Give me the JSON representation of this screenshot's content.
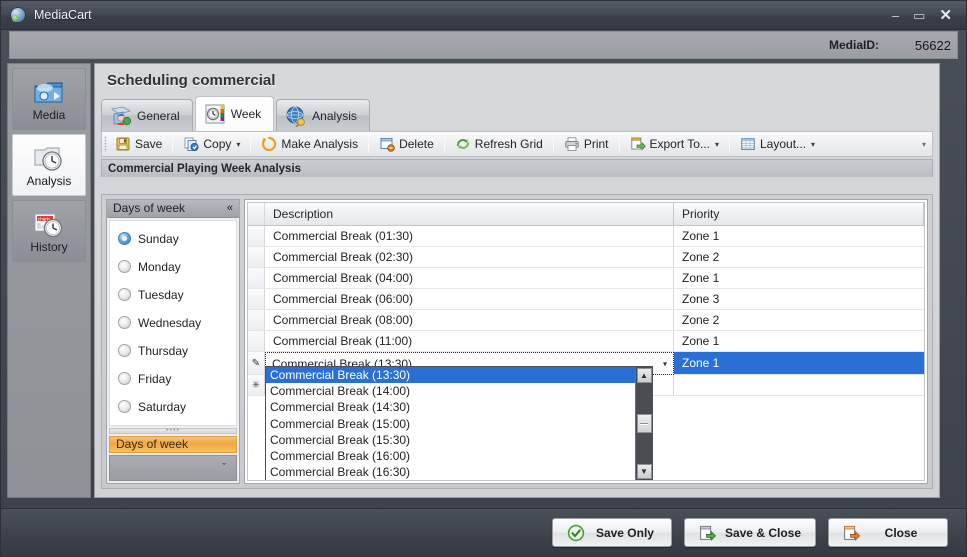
{
  "window": {
    "title": "MediaCart",
    "icon": "app-globe-icon",
    "minimize": "–",
    "maximize": "▭",
    "close": "✕"
  },
  "header": {
    "media_id_label": "MediaID:",
    "media_id_value": "56622"
  },
  "sidebar": {
    "items": [
      {
        "label": "Media",
        "icon": "media-folder-icon",
        "active": false
      },
      {
        "label": "Analysis",
        "icon": "analysis-clock-icon",
        "active": true
      },
      {
        "label": "History",
        "icon": "history-chart-icon",
        "active": false
      }
    ]
  },
  "content": {
    "title": "Scheduling commercial",
    "tabs": [
      {
        "label": "General",
        "icon": "general-person-icon",
        "active": false
      },
      {
        "label": "Week",
        "icon": "week-calendar-icon",
        "active": true
      },
      {
        "label": "Analysis",
        "icon": "analysis-globe-icon",
        "active": false
      }
    ],
    "group_caption": "Commercial Playing Week Analysis"
  },
  "toolbar": {
    "overflow": "▾",
    "buttons": [
      {
        "label": "Save",
        "icon": "save-disk-icon",
        "dropdown": false,
        "separator_after": true
      },
      {
        "label": "Copy",
        "icon": "copy-icon",
        "dropdown": true,
        "separator_after": true
      },
      {
        "label": "Make Analysis",
        "icon": "make-analysis-icon",
        "dropdown": false,
        "separator_after": true
      },
      {
        "label": "Delete",
        "icon": "delete-icon",
        "dropdown": false,
        "separator_after": true
      },
      {
        "label": "Refresh Grid",
        "icon": "refresh-icon",
        "dropdown": false,
        "separator_after": true
      },
      {
        "label": "Print",
        "icon": "print-icon",
        "dropdown": false,
        "separator_after": true
      },
      {
        "label": "Export To...",
        "icon": "export-icon",
        "dropdown": true,
        "separator_after": true
      },
      {
        "label": "Layout...",
        "icon": "layout-icon",
        "dropdown": true,
        "separator_after": false
      }
    ]
  },
  "dock_panel": {
    "header": "Days of week",
    "collapse_icon": "«",
    "tab_label": "Days of week",
    "footer_chevron": "ˇ",
    "days": [
      {
        "label": "Sunday",
        "checked": true
      },
      {
        "label": "Monday",
        "checked": false
      },
      {
        "label": "Tuesday",
        "checked": false
      },
      {
        "label": "Wednesday",
        "checked": false
      },
      {
        "label": "Thursday",
        "checked": false
      },
      {
        "label": "Friday",
        "checked": false
      },
      {
        "label": "Saturday",
        "checked": false
      }
    ]
  },
  "grid": {
    "columns": [
      "Description",
      "Priority"
    ],
    "rows": [
      {
        "description": "Commercial Break (01:30)",
        "priority": "Zone 1",
        "indicator": "",
        "selected": false,
        "editing": false
      },
      {
        "description": "Commercial Break (02:30)",
        "priority": "Zone 2",
        "indicator": "",
        "selected": false,
        "editing": false
      },
      {
        "description": "Commercial Break (04:00)",
        "priority": "Zone 1",
        "indicator": "",
        "selected": false,
        "editing": false
      },
      {
        "description": "Commercial Break (06:00)",
        "priority": "Zone 3",
        "indicator": "",
        "selected": false,
        "editing": false
      },
      {
        "description": "Commercial Break (08:00)",
        "priority": "Zone 2",
        "indicator": "",
        "selected": false,
        "editing": false
      },
      {
        "description": "Commercial Break (11:00)",
        "priority": "Zone 1",
        "indicator": "",
        "selected": false,
        "editing": false
      },
      {
        "description": "Commercial Break (13:30)",
        "priority": "Zone 1",
        "indicator": "✎",
        "selected": true,
        "editing": true
      },
      {
        "description": "",
        "priority": "",
        "indicator": "✳",
        "selected": false,
        "editing": false
      }
    ],
    "editor_dropdown_caret": "▾"
  },
  "dropdown": {
    "options": [
      {
        "label": "Commercial Break (13:30)",
        "selected": true
      },
      {
        "label": "Commercial Break (14:00)",
        "selected": false
      },
      {
        "label": "Commercial Break (14:30)",
        "selected": false
      },
      {
        "label": "Commercial Break (15:00)",
        "selected": false
      },
      {
        "label": "Commercial Break (15:30)",
        "selected": false
      },
      {
        "label": "Commercial Break (16:00)",
        "selected": false
      },
      {
        "label": "Commercial Break (16:30)",
        "selected": false
      }
    ],
    "scroll_up": "▲",
    "scroll_down": "▼"
  },
  "footer": {
    "buttons": [
      {
        "label": "Save Only",
        "icon": "check-circle-icon"
      },
      {
        "label": "Save & Close",
        "icon": "save-close-icon"
      },
      {
        "label": "Close",
        "icon": "close-window-icon"
      }
    ]
  },
  "colors": {
    "accent_selection": "#2a6fd4",
    "dock_tab_orange": "#f2a63f",
    "title_bar": "#454b54"
  }
}
